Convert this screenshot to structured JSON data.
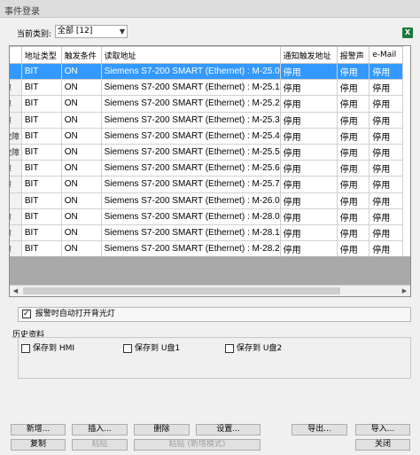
{
  "window": {
    "title": "事件登录"
  },
  "category": {
    "label": "当前类别:",
    "selected": "全部 [12]"
  },
  "icons": {
    "excel": "excel-export-icon",
    "checkmark": "checkmark-icon",
    "dropdown": "chevron-down-icon"
  },
  "table": {
    "columns": [
      "地址类型",
      "触发条件",
      "读取地址",
      "通知触发地址",
      "报警声",
      "e-Mail"
    ],
    "rows": [
      {
        "rh": "",
        "type": "BIT",
        "cond": "ON",
        "addr": "Siemens S7-200 SMART (Ethernet) : M-25.0",
        "notify": "停用",
        "sound": "停用",
        "mail": "停用"
      },
      {
        "rh": "障",
        "type": "BIT",
        "cond": "ON",
        "addr": "Siemens S7-200 SMART (Ethernet) : M-25.1",
        "notify": "停用",
        "sound": "停用",
        "mail": "停用"
      },
      {
        "rh": "障",
        "type": "BIT",
        "cond": "ON",
        "addr": "Siemens S7-200 SMART (Ethernet) : M-25.2",
        "notify": "停用",
        "sound": "停用",
        "mail": "停用"
      },
      {
        "rh": "障",
        "type": "BIT",
        "cond": "ON",
        "addr": "Siemens S7-200 SMART (Ethernet) : M-25.3",
        "notify": "停用",
        "sound": "停用",
        "mail": "停用"
      },
      {
        "rh": "故障",
        "type": "BIT",
        "cond": "ON",
        "addr": "Siemens S7-200 SMART (Ethernet) : M-25.4",
        "notify": "停用",
        "sound": "停用",
        "mail": "停用"
      },
      {
        "rh": "故障",
        "type": "BIT",
        "cond": "ON",
        "addr": "Siemens S7-200 SMART (Ethernet) : M-25.5",
        "notify": "停用",
        "sound": "停用",
        "mail": "停用"
      },
      {
        "rh": "障",
        "type": "BIT",
        "cond": "ON",
        "addr": "Siemens S7-200 SMART (Ethernet) : M-25.6",
        "notify": "停用",
        "sound": "停用",
        "mail": "停用"
      },
      {
        "rh": "障",
        "type": "BIT",
        "cond": "ON",
        "addr": "Siemens S7-200 SMART (Ethernet) : M-25.7",
        "notify": "停用",
        "sound": "停用",
        "mail": "停用"
      },
      {
        "rh": "",
        "type": "BIT",
        "cond": "ON",
        "addr": "Siemens S7-200 SMART (Ethernet) : M-26.0",
        "notify": "停用",
        "sound": "停用",
        "mail": "停用"
      },
      {
        "rh": "障",
        "type": "BIT",
        "cond": "ON",
        "addr": "Siemens S7-200 SMART (Ethernet) : M-28.0",
        "notify": "停用",
        "sound": "停用",
        "mail": "停用"
      },
      {
        "rh": "障",
        "type": "BIT",
        "cond": "ON",
        "addr": "Siemens S7-200 SMART (Ethernet) : M-28.1",
        "notify": "停用",
        "sound": "停用",
        "mail": "停用"
      },
      {
        "rh": "障",
        "type": "BIT",
        "cond": "ON",
        "addr": "Siemens S7-200 SMART (Ethernet) : M-28.2",
        "notify": "停用",
        "sound": "停用",
        "mail": "停用"
      }
    ]
  },
  "auto_light": {
    "label": "报警时自动打开背光灯",
    "checked": true
  },
  "history": {
    "title": "历史资料",
    "options": [
      {
        "label": "保存到 HMI",
        "checked": false
      },
      {
        "label": "保存到 U盘1",
        "checked": false
      },
      {
        "label": "保存到 U盘2",
        "checked": false
      }
    ]
  },
  "buttons": {
    "new": "新增...",
    "insert": "插入...",
    "delete": "删除",
    "settings": "设置...",
    "export": "导出...",
    "import": "导入...",
    "copy": "复制",
    "paste": "粘贴",
    "paste_append": "粘贴 (新增模式)",
    "close": "关闭"
  }
}
